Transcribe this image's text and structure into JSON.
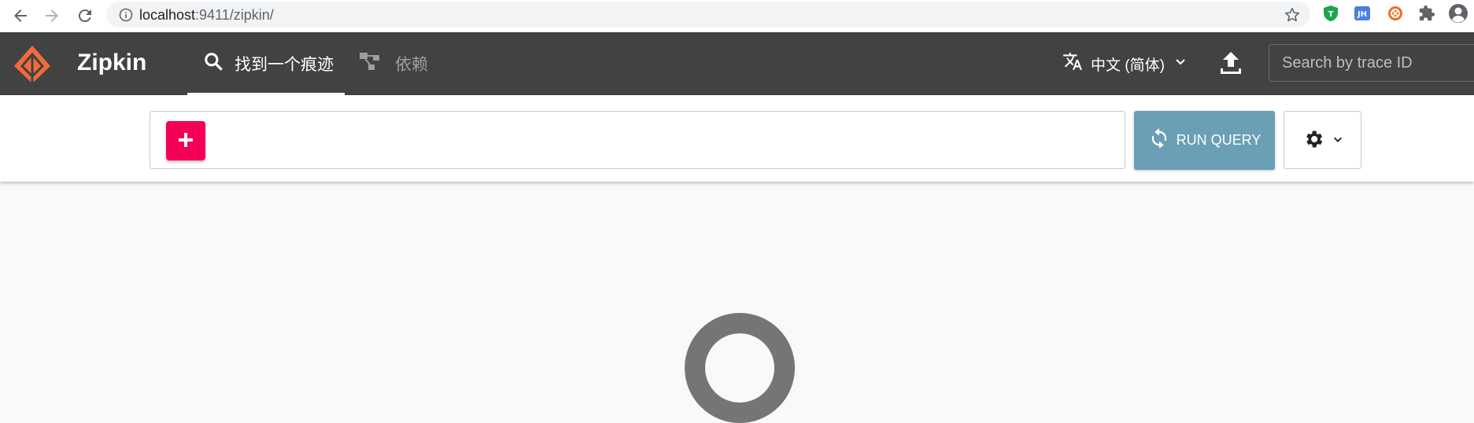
{
  "browser": {
    "url_host": "localhost",
    "url_rest": ":9411/zipkin/",
    "extensions": [
      "shield-extension-icon",
      "jh-extension-icon",
      "orange-extension-icon",
      "puzzle-extensions-icon",
      "profile-avatar-icon"
    ],
    "extension_jh_label": "JH"
  },
  "header": {
    "brand": "Zipkin",
    "tabs": [
      {
        "label": "找到一个痕迹",
        "active": true
      },
      {
        "label": "依赖",
        "active": false
      }
    ],
    "language": "中文 (简体)",
    "trace_search_placeholder": "Search by trace ID"
  },
  "query": {
    "run_label": "RUN QUERY"
  },
  "colors": {
    "header_bg": "#424242",
    "logo_orange": "#f26b3a",
    "add_button": "#f50057",
    "run_button": "#6a9fb5",
    "spinner": "#757575"
  }
}
